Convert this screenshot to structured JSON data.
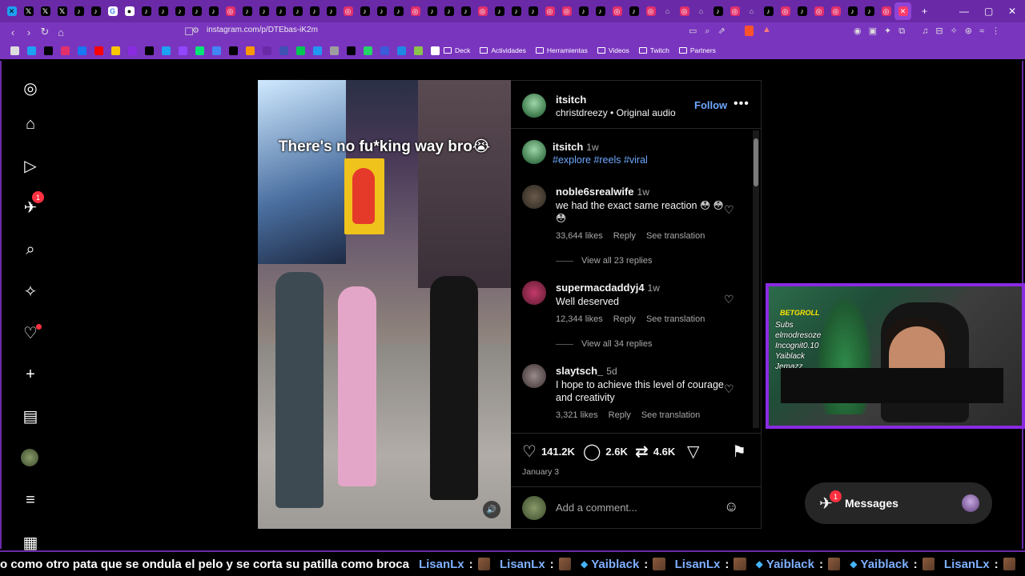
{
  "browser": {
    "url": "instagram.com/p/DTEbas-iK2m",
    "tab_count_visible": 54,
    "window_controls": [
      "—",
      "▢",
      "✕"
    ],
    "new_tab": "+",
    "bookmarks": [
      {
        "label": "Deck"
      },
      {
        "label": "Actividades"
      },
      {
        "label": "Herramientas"
      },
      {
        "label": "Videos"
      },
      {
        "label": "Twitch"
      },
      {
        "label": "Partners"
      }
    ]
  },
  "sidenav": {
    "items": [
      {
        "name": "instagram-logo-icon",
        "glyph": "◎"
      },
      {
        "name": "home-icon",
        "glyph": "⌂"
      },
      {
        "name": "reels-icon",
        "glyph": "▷"
      },
      {
        "name": "direct-icon",
        "glyph": "✈",
        "badge": "1"
      },
      {
        "name": "search-icon",
        "glyph": "⌕"
      },
      {
        "name": "explore-icon",
        "glyph": "✧"
      },
      {
        "name": "notifications-icon",
        "glyph": "♡"
      },
      {
        "name": "create-icon",
        "glyph": "+"
      },
      {
        "name": "dashboard-icon",
        "glyph": "▤"
      },
      {
        "name": "profile-icon",
        "glyph": ""
      },
      {
        "name": "menu-icon",
        "glyph": "≡"
      },
      {
        "name": "also-from-meta-icon",
        "glyph": "▦"
      }
    ]
  },
  "post": {
    "video_caption": "There's no fu*king way bro😭",
    "author": "itsitch",
    "audio_author": "christdreezy",
    "audio_separator": "•",
    "audio_label": "Original audio",
    "follow_label": "Follow",
    "more_label": "•••",
    "caption": {
      "user": "itsitch",
      "time": "1w",
      "tags": "#explore #reels #viral"
    },
    "comments": [
      {
        "user": "noble6srealwife",
        "time": "1w",
        "text": "we had the exact same reaction 😳 😳 😳",
        "likes": "33,644 likes",
        "reply": "Reply",
        "translation": "See translation",
        "view_replies": "View all 23 replies"
      },
      {
        "user": "supermacdaddyj4",
        "time": "1w",
        "text": "Well deserved",
        "likes": "12,344 likes",
        "reply": "Reply",
        "translation": "See translation",
        "view_replies": "View all 34 replies"
      },
      {
        "user": "slaytsch_",
        "time": "5d",
        "text": "I hope to achieve this level of courage and creativity",
        "likes": "3,321 likes",
        "reply": "Reply",
        "translation": "See translation"
      }
    ],
    "actions": {
      "likes": "141.2K",
      "comments": "2.6K",
      "reposts": "4.6K"
    },
    "date": "January 3",
    "add_comment_placeholder": "Add a comment..."
  },
  "webcam": {
    "brand": "BETGROLL",
    "subs_label": "Subs",
    "names": [
      "elmodresoze",
      "Incognit0.10",
      "Yaiblack",
      "Jemazz"
    ]
  },
  "messages": {
    "label": "Messages",
    "badge": "1"
  },
  "ticker": {
    "message": "o como otro pata que se ondula el pelo y se corta su patilla como broca",
    "entries": [
      {
        "name": "LisanLx",
        "gem": false
      },
      {
        "name": "LisanLx",
        "gem": false
      },
      {
        "name": "Yaiblack",
        "gem": true
      },
      {
        "name": "LisanLx",
        "gem": false
      },
      {
        "name": "Yaiblack",
        "gem": true
      },
      {
        "name": "Yaiblack",
        "gem": true
      },
      {
        "name": "LisanLx",
        "gem": false
      }
    ]
  },
  "colors": {
    "chrome_purple": "#6a2aa8",
    "link_blue": "#6ea8ff",
    "badge_red": "#ff3040",
    "webcam_border": "#8a2be2"
  }
}
